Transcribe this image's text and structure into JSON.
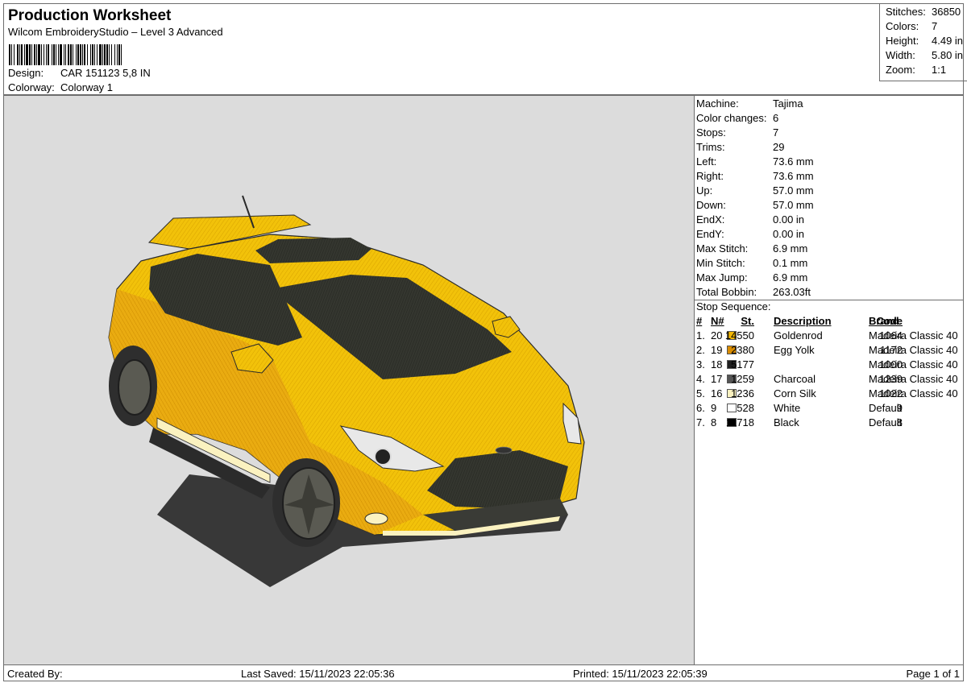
{
  "header": {
    "title": "Production Worksheet",
    "software": "Wilcom EmbroideryStudio – Level 3 Advanced",
    "design_label": "Design:",
    "design": "CAR 151123 5,8 IN",
    "colorway_label": "Colorway:",
    "colorway": "Colorway 1"
  },
  "stats": [
    {
      "label": "Stitches:",
      "value": "36850"
    },
    {
      "label": "Colors:",
      "value": "7"
    },
    {
      "label": "Height:",
      "value": "4.49 in"
    },
    {
      "label": "Width:",
      "value": "5.80 in"
    },
    {
      "label": "Zoom:",
      "value": "1:1"
    }
  ],
  "machine_info": [
    {
      "label": "Machine:",
      "value": "Tajima"
    },
    {
      "label": "Color changes:",
      "value": "6"
    },
    {
      "label": "Stops:",
      "value": "7"
    },
    {
      "label": "Trims:",
      "value": "29"
    },
    {
      "label": "Left:",
      "value": "73.6 mm"
    },
    {
      "label": "Right:",
      "value": "73.6 mm"
    },
    {
      "label": "Up:",
      "value": "57.0 mm"
    },
    {
      "label": "Down:",
      "value": "57.0 mm"
    },
    {
      "label": "EndX:",
      "value": "0.00 in"
    },
    {
      "label": "EndY:",
      "value": "0.00 in"
    },
    {
      "label": "Max Stitch:",
      "value": "6.9 mm"
    },
    {
      "label": "Min Stitch:",
      "value": "0.1 mm"
    },
    {
      "label": "Max Jump:",
      "value": "6.9 mm"
    },
    {
      "label": "Total Bobbin:",
      "value": "263.03ft"
    }
  ],
  "stop_sequence": {
    "label": "Stop Sequence:",
    "headers": {
      "num": "#",
      "needle": "N#",
      "stitches": "St.",
      "description": "Description",
      "code": "Code",
      "brand": "Brand"
    },
    "rows": [
      {
        "num": "1.",
        "needle": "20",
        "color": "#f2b705",
        "stitches": "14550",
        "description": "Goldenrod",
        "code": "1064",
        "brand": "Madeira Classic 40"
      },
      {
        "num": "2.",
        "needle": "19",
        "color": "#d98c00",
        "stitches": "2380",
        "description": "Egg Yolk",
        "code": "1172",
        "brand": "Madeira Classic 40"
      },
      {
        "num": "3.",
        "needle": "18",
        "color": "#1e1e1e",
        "stitches": "5177",
        "description": "",
        "code": "1000",
        "brand": "Madeira Classic 40"
      },
      {
        "num": "4.",
        "needle": "17",
        "color": "#555555",
        "stitches": "1259",
        "description": "Charcoal",
        "code": "1239",
        "brand": "Madeira Classic 40"
      },
      {
        "num": "5.",
        "needle": "16",
        "color": "#fbf2c0",
        "stitches": "1236",
        "description": "Corn Silk",
        "code": "1022",
        "brand": "Madeira Classic 40"
      },
      {
        "num": "6.",
        "needle": "9",
        "color": "#ffffff",
        "stitches": "528",
        "description": "White",
        "code": "9",
        "brand": "Default"
      },
      {
        "num": "7.",
        "needle": "8",
        "color": "#000000",
        "stitches": "11718",
        "description": "Black",
        "code": "8",
        "brand": "Default"
      }
    ]
  },
  "footer": {
    "created_by": "Created By:",
    "last_saved": "Last Saved: 15/11/2023 22:05:36",
    "printed": "Printed: 15/11/2023 22:05:39",
    "page": "Page 1 of 1"
  },
  "colors": {
    "goldenrod": "#f2b705",
    "egg_yolk": "#d98c00",
    "dark": "#2a2c28",
    "charcoal": "#555555",
    "corn_silk": "#fbf2c0",
    "preview_bg": "#dcdcdc"
  }
}
